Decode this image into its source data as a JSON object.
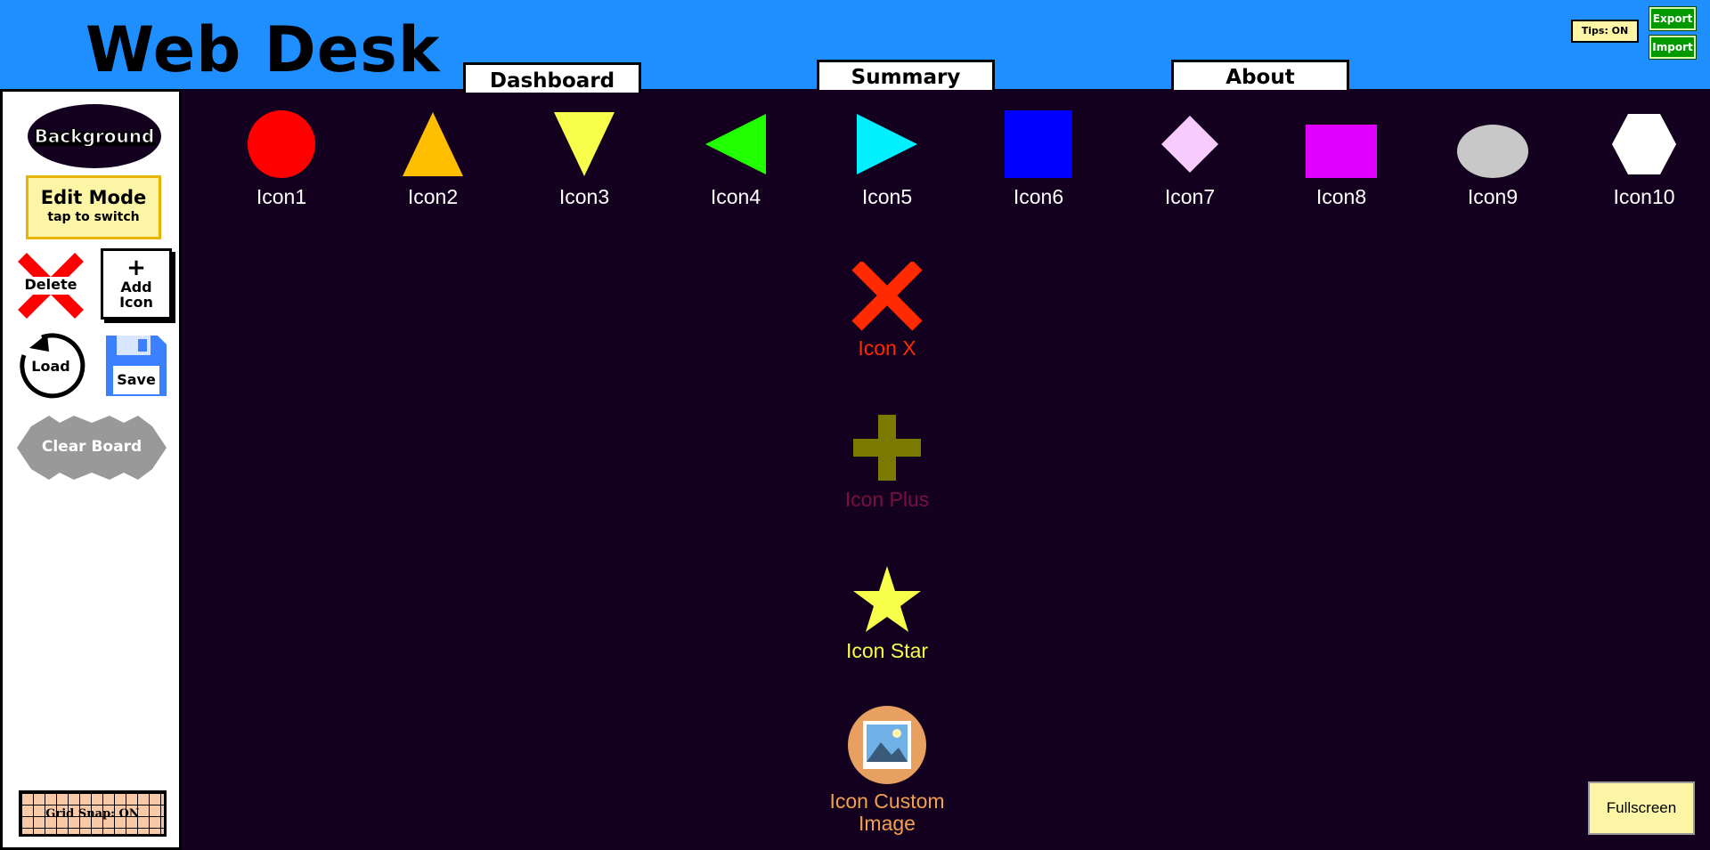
{
  "header": {
    "title": "Web Desk",
    "tabs": [
      "Dashboard",
      "Summary",
      "About"
    ],
    "tips_label": "Tips: ON",
    "export_label": "Export",
    "import_label": "Import"
  },
  "sidebar": {
    "background_label": "Background",
    "edit_mode_title": "Edit Mode",
    "edit_mode_sub": "tap to switch",
    "delete_label": "Delete",
    "add_icon_plus": "+",
    "add_icon_label": "Add Icon",
    "load_label": "Load",
    "save_label": "Save",
    "clear_label": "Clear Board",
    "grid_snap_label": "Grid Snap: ON"
  },
  "icons": [
    {
      "label": "Icon1",
      "shape": "circle-icon",
      "color": "#ff0000",
      "label_color": "#ffffff"
    },
    {
      "label": "Icon2",
      "shape": "triangle-up-icon",
      "color": "#ffbf00",
      "label_color": "#ffffff"
    },
    {
      "label": "Icon3",
      "shape": "triangle-down-icon",
      "color": "#f7ff4a",
      "label_color": "#ffffff"
    },
    {
      "label": "Icon4",
      "shape": "triangle-left-icon",
      "color": "#22ff00",
      "label_color": "#ffffff"
    },
    {
      "label": "Icon5",
      "shape": "triangle-right-icon",
      "color": "#00f0ff",
      "label_color": "#ffffff"
    },
    {
      "label": "Icon6",
      "shape": "square-icon",
      "color": "#0000ff",
      "label_color": "#ffffff"
    },
    {
      "label": "Icon7",
      "shape": "diamond-icon",
      "color": "#f8ccff",
      "label_color": "#ffffff"
    },
    {
      "label": "Icon8",
      "shape": "rectangle-icon",
      "color": "#e000ff",
      "label_color": "#ffffff"
    },
    {
      "label": "Icon9",
      "shape": "ellipse-icon",
      "color": "#c8c8c8",
      "label_color": "#ffffff"
    },
    {
      "label": "Icon10",
      "shape": "hexagon-icon",
      "color": "#ffffff",
      "label_color": "#ffffff"
    },
    {
      "label": "Icon X",
      "shape": "x-icon",
      "color": "#ff2a00",
      "label_color": "#ff2a00"
    },
    {
      "label": "Icon Plus",
      "shape": "plus-icon",
      "color": "#7a7a00",
      "label_color": "#7a1040"
    },
    {
      "label": "Icon Star",
      "shape": "star-icon",
      "color": "#f7ff4a",
      "label_color": "#f7ff4a"
    },
    {
      "label": "Icon Custom Image",
      "shape": "image-icon",
      "color": "#e8a060",
      "label_color": "#f0a050"
    }
  ],
  "fullscreen_label": "Fullscreen"
}
